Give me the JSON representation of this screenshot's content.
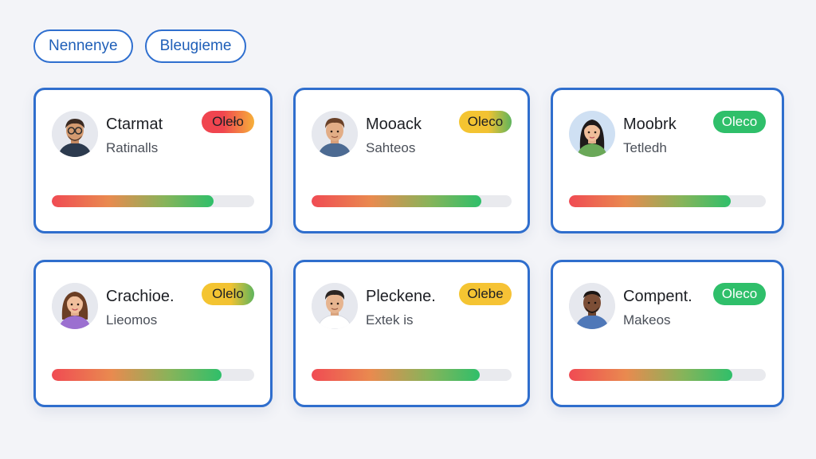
{
  "filters": [
    {
      "label": "Nennenye"
    },
    {
      "label": "Bleugieme"
    }
  ],
  "colors": {
    "accent": "#2f6ecd",
    "badge_red_orange": "linear-gradient(90deg,#f0454f,#f6b03a)",
    "badge_yellow_green": "linear-gradient(90deg,#f4c531,#f2c232 55%,#5fb45d)",
    "badge_green": "#2fbf6a"
  },
  "cards": [
    {
      "name": "Ctarmat",
      "role": "Ratinalls",
      "badge": "Oleło",
      "badge_style": "red-orange",
      "avatar": "man-glasses-avatar",
      "progress": 0.8
    },
    {
      "name": "Mooack",
      "role": "Sahteos",
      "badge": "Oleco",
      "badge_style": "yellow-green",
      "avatar": "man-avatar",
      "progress": 0.85
    },
    {
      "name": "Moobrk",
      "role": "Tetledh",
      "badge": "Oleco",
      "badge_style": "green",
      "avatar": "woman-dark-hair-avatar",
      "progress": 0.82
    },
    {
      "name": "Crachioe.",
      "role": "Lieomos",
      "badge": "Olelo",
      "badge_style": "yellow-green",
      "avatar": "woman-brown-hair-avatar",
      "progress": 0.84
    },
    {
      "name": "Pleckene.",
      "role": "Extek is",
      "badge": "Olebe",
      "badge_style": "yellow",
      "avatar": "man-short-hair-avatar",
      "progress": 0.84
    },
    {
      "name": "Compent.",
      "role": "Makeos",
      "badge": "Oleco",
      "badge_style": "green",
      "avatar": "man-dark-skin-avatar",
      "progress": 0.83
    }
  ]
}
